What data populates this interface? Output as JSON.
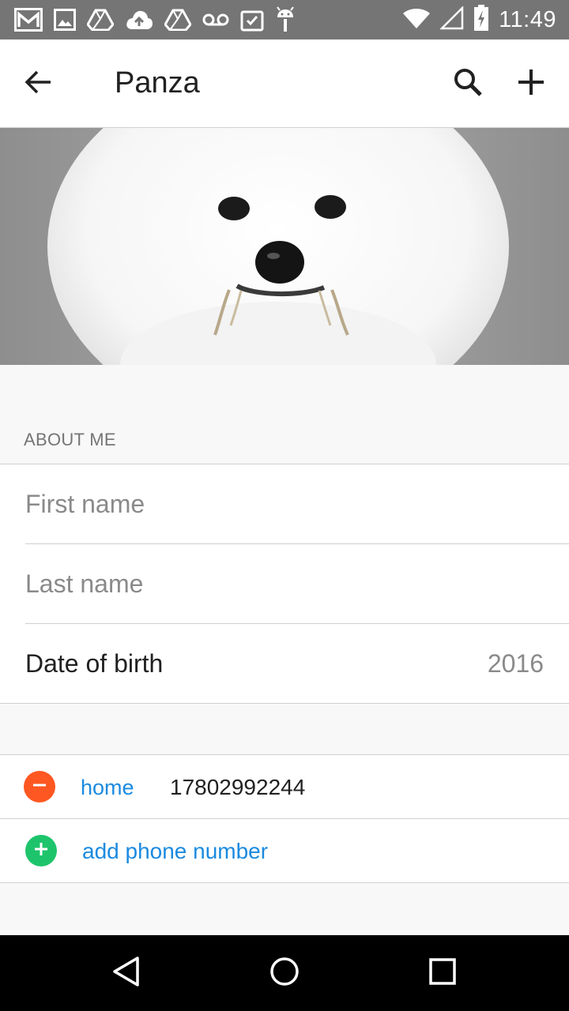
{
  "status_bar": {
    "time": "11:49",
    "icons": [
      "gmail-icon",
      "image-icon",
      "drive-icon",
      "cloud-upload-icon",
      "drive-icon",
      "voicemail-icon",
      "clipboard-check-icon",
      "android-icon",
      "wifi-icon",
      "signal-icon",
      "battery-charging-icon"
    ]
  },
  "toolbar": {
    "title": "Panza",
    "back_icon": "arrow-back-icon",
    "search_icon": "search-icon",
    "add_icon": "plus-icon"
  },
  "about": {
    "header": "ABOUT ME",
    "first_name_placeholder": "First name",
    "last_name_placeholder": "Last name",
    "dob_label": "Date of birth",
    "dob_value": "2016"
  },
  "phone": {
    "type": "home",
    "number": "17802992244",
    "add_label": "add phone number"
  },
  "colors": {
    "status_bar": "#757575",
    "accent_blue": "#1a8ae0",
    "remove_red": "#ff5722",
    "add_green": "#1ec46b"
  },
  "nav": [
    "back-icon",
    "home-icon",
    "recents-icon"
  ]
}
